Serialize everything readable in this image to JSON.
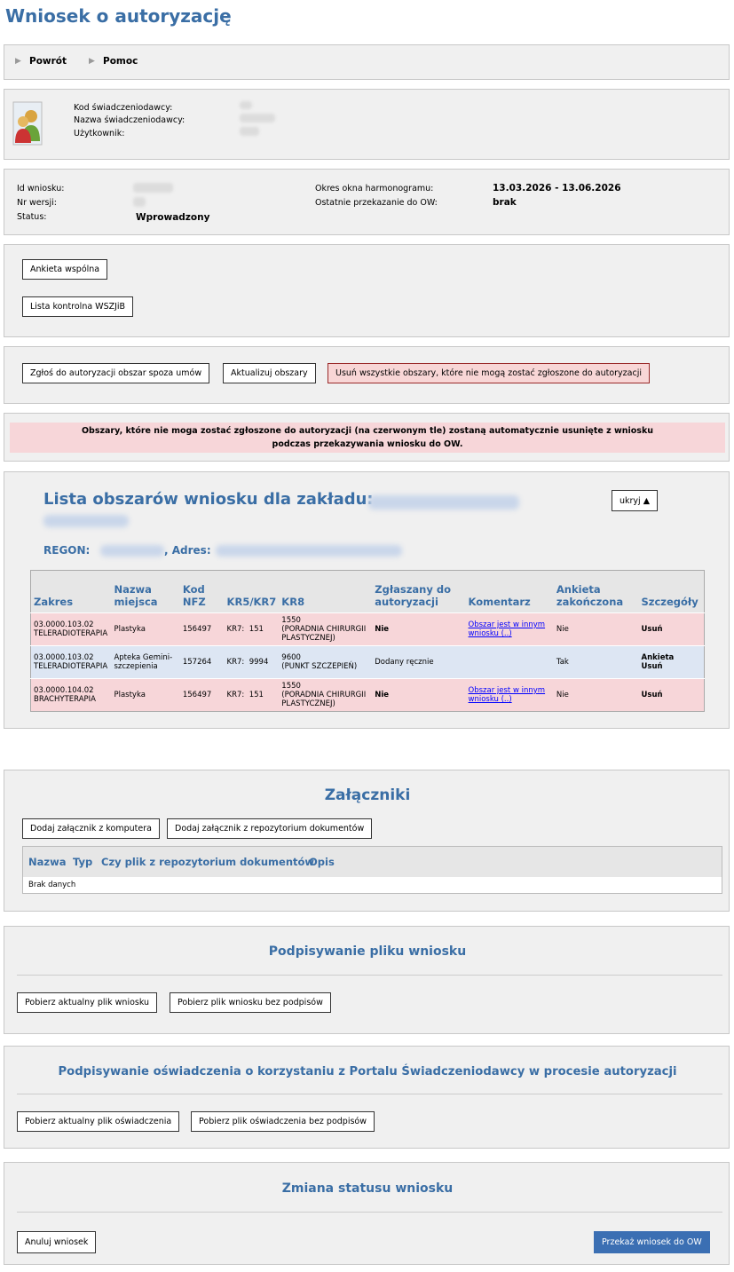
{
  "page_title": "Wniosek o autoryzację",
  "toolbar": {
    "back": "Powrót",
    "help": "Pomoc"
  },
  "provider": {
    "code_label": "Kod świadczeniodawcy:",
    "name_label": "Nazwa świadczeniodawcy:",
    "user_label": "Użytkownik:"
  },
  "request": {
    "id_label": "Id wniosku:",
    "version_label": "Nr wersji:",
    "status_label": "Status:",
    "status_value": "Wprowadzony",
    "window_label": "Okres okna harmonogramu:",
    "window_value": "13.03.2026 - 13.06.2026",
    "last_label": "Ostatnie przekazanie do OW:",
    "last_value": "brak"
  },
  "forms": {
    "common": "Ankieta wspólna",
    "checklist": "Lista kontrolna WSZJiB"
  },
  "area_actions": {
    "report": "Zgłoś do autoryzacji obszar spoza umów",
    "update": "Aktualizuj obszary",
    "remove_all": "Usuń wszystkie obszary, które nie mogą zostać zgłoszone do autoryzacji"
  },
  "warning": {
    "line1": "Obszary, które nie moga zostać zgłoszone do autoryzacji (na czerwonym tle) zostaną automatycznie usunięte z wniosku",
    "line2": "podczas przekazywania wniosku do OW."
  },
  "areas": {
    "title": "Lista obszarów wniosku dla zakładu:",
    "hide": "ukryj ▲",
    "regon_label": "REGON:",
    "address_label": ", Adres:",
    "columns": [
      "Zakres",
      "Nazwa miejsca",
      "Kod NFZ",
      "KR5/KR7",
      "KR8",
      "Zgłaszany do autoryzacji",
      "Komentarz",
      "Ankieta zakończona",
      "Szczegóły"
    ],
    "rows": [
      {
        "zakres1": "03.0000.103.02",
        "zakres2": "TELERADIOTERAPIA",
        "place": "Plastyka",
        "nfz": "156497",
        "kr_label": "KR7:",
        "kr": "151",
        "kr8_1": "1550",
        "kr8_2": "(PORADNIA CHIRURGII",
        "kr8_3": "PLASTYCZNEJ)",
        "auth": "Nie",
        "comment": "Obszar jest w innym wniosku (..)",
        "survey": "Nie",
        "details1": "Usuń",
        "details2": ""
      },
      {
        "zakres1": "03.0000.103.02",
        "zakres2": "TELERADIOTERAPIA",
        "place": "Apteka Gemini-szczepienia",
        "nfz": "157264",
        "kr_label": "KR7:",
        "kr": "9994",
        "kr8_1": "9600",
        "kr8_2": "(PUNKT SZCZEPIEŃ)",
        "kr8_3": "",
        "auth": "Dodany ręcznie",
        "comment": "",
        "survey": "Tak",
        "details1": "Ankieta",
        "details2": "Usuń"
      },
      {
        "zakres1": "03.0000.104.02",
        "zakres2": "BRACHYTERAPIA",
        "place": "Plastyka",
        "nfz": "156497",
        "kr_label": "KR7:",
        "kr": "151",
        "kr8_1": "1550",
        "kr8_2": "(PORADNIA CHIRURGII",
        "kr8_3": "PLASTYCZNEJ)",
        "auth": "Nie",
        "comment": "Obszar jest w innym wniosku (..)",
        "survey": "Nie",
        "details1": "Usuń",
        "details2": ""
      }
    ]
  },
  "attachments": {
    "title": "Załączniki",
    "add_computer": "Dodaj załącznik z komputera",
    "add_repo": "Dodaj załącznik z repozytorium dokumentów",
    "columns": [
      "Nazwa",
      "Typ",
      "Czy plik z repozytorium dokumentów",
      "Opis"
    ],
    "empty": "Brak danych"
  },
  "signing": {
    "title": "Podpisywanie pliku wniosku",
    "download_current": "Pobierz aktualny plik wniosku",
    "download_unsigned": "Pobierz plik wniosku bez podpisów"
  },
  "declaration": {
    "title": "Podpisywanie oświadczenia o korzystaniu z Portalu Świadczeniodawcy w procesie autoryzacji",
    "download_current": "Pobierz aktualny plik oświadczenia",
    "download_unsigned": "Pobierz plik oświadczenia bez podpisów"
  },
  "status_change": {
    "title": "Zmiana statusu wniosku",
    "cancel": "Anuluj wniosek",
    "submit": "Przekaż wniosek do OW"
  },
  "colors": {
    "accent": "#3a6ea5",
    "error_bg": "#f7d6d9",
    "manual_bg": "#dde6f3",
    "submit_bg": "#3b6fb3"
  }
}
